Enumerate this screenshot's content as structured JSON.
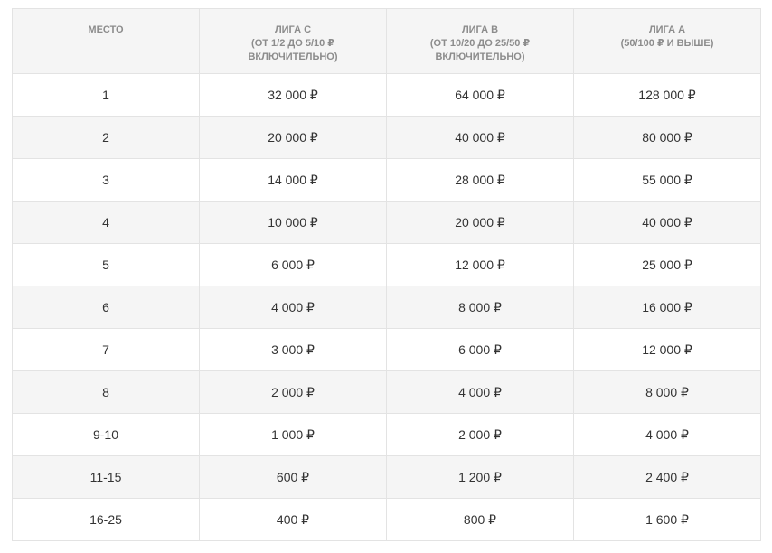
{
  "table": {
    "headers": [
      {
        "lines": [
          "МЕСТО"
        ]
      },
      {
        "lines": [
          "ЛИГА C",
          "(ОТ 1/2 ДО 5/10 ₽",
          "ВКЛЮЧИТЕЛЬНО)"
        ]
      },
      {
        "lines": [
          "ЛИГА B",
          "(ОТ 10/20 ДО 25/50 ₽",
          "ВКЛЮЧИТЕЛЬНО)"
        ]
      },
      {
        "lines": [
          "ЛИГА A",
          "(50/100 ₽ И ВЫШЕ)"
        ]
      }
    ],
    "rows": [
      [
        "1",
        "32 000 ₽",
        "64 000 ₽",
        "128 000 ₽"
      ],
      [
        "2",
        "20 000 ₽",
        "40 000 ₽",
        "80 000 ₽"
      ],
      [
        "3",
        "14 000 ₽",
        "28 000 ₽",
        "55 000 ₽"
      ],
      [
        "4",
        "10 000 ₽",
        "20 000 ₽",
        "40 000 ₽"
      ],
      [
        "5",
        "6 000 ₽",
        "12 000 ₽",
        "25 000 ₽"
      ],
      [
        "6",
        "4 000 ₽",
        "8 000 ₽",
        "16 000 ₽"
      ],
      [
        "7",
        "3 000 ₽",
        "6 000 ₽",
        "12 000 ₽"
      ],
      [
        "8",
        "2 000 ₽",
        "4 000 ₽",
        "8 000 ₽"
      ],
      [
        "9-10",
        "1 000 ₽",
        "2 000 ₽",
        "4 000 ₽"
      ],
      [
        "11-15",
        "600 ₽",
        "1 200 ₽",
        "2 400 ₽"
      ],
      [
        "16-25",
        "400 ₽",
        "800 ₽",
        "1 600 ₽"
      ]
    ]
  }
}
